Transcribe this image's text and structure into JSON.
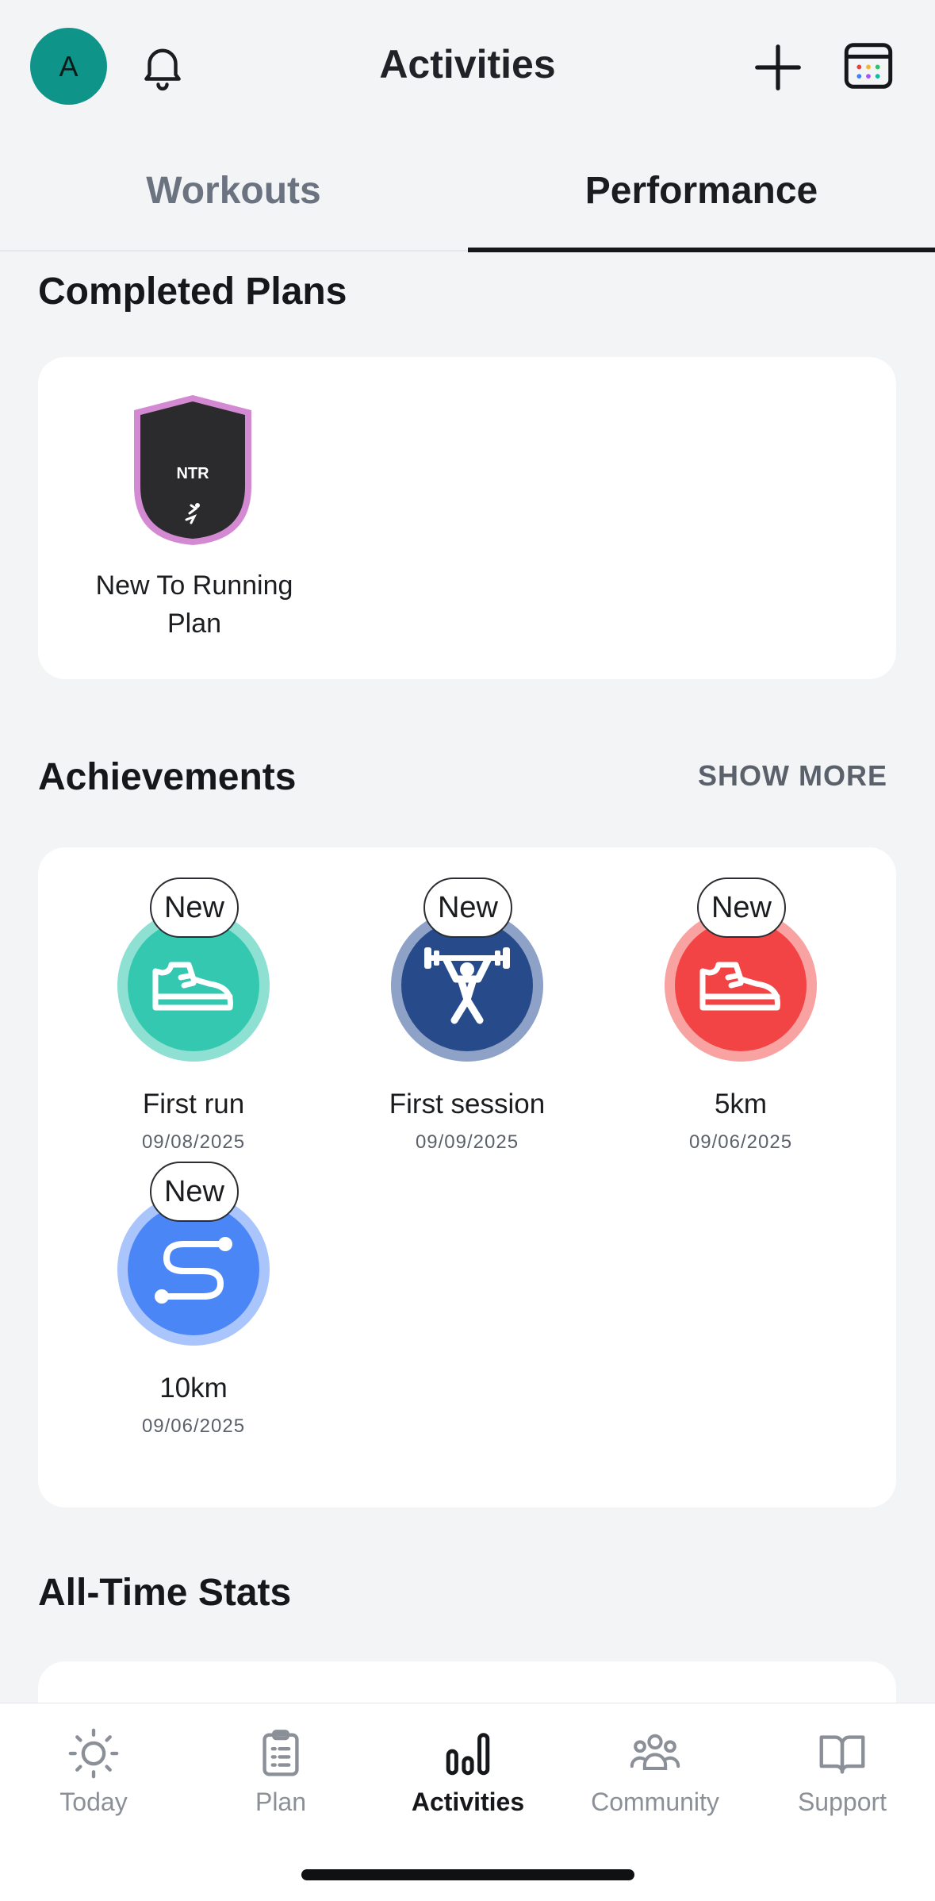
{
  "header": {
    "avatar_initial": "A",
    "title": "Activities"
  },
  "tabs": [
    {
      "label": "Workouts",
      "active": false
    },
    {
      "label": "Performance",
      "active": true
    }
  ],
  "completed_plans": {
    "title": "Completed Plans",
    "plans": [
      {
        "badge_text": "NTR",
        "label": "New To Running Plan",
        "label_line1": "New To Running",
        "label_line2": "Plan",
        "border_color": "#d38ad2"
      }
    ]
  },
  "achievements": {
    "title": "Achievements",
    "show_more": "SHOW MORE",
    "items": [
      {
        "badge": "New",
        "name": "First run",
        "date": "09/08/2025",
        "icon": "shoe-icon",
        "color": "#34c8b1",
        "ring": "#8de0d2"
      },
      {
        "badge": "New",
        "name": "First session",
        "date": "09/09/2025",
        "icon": "weightlifter-icon",
        "color": "#264a8a",
        "ring": "#8ea1c6"
      },
      {
        "badge": "New",
        "name": "5km",
        "date": "09/06/2025",
        "icon": "shoe-icon",
        "color": "#f24444",
        "ring": "#f8a2a2"
      },
      {
        "badge": "New",
        "name": "10km",
        "date": "09/06/2025",
        "icon": "route-icon",
        "color": "#4b86f7",
        "ring": "#a9c5fb"
      }
    ]
  },
  "stats": {
    "title": "All-Time Stats"
  },
  "bottom_nav": [
    {
      "label": "Today",
      "icon": "sun-icon",
      "active": false
    },
    {
      "label": "Plan",
      "icon": "clipboard-icon",
      "active": false
    },
    {
      "label": "Activities",
      "icon": "bar-chart-icon",
      "active": true
    },
    {
      "label": "Community",
      "icon": "people-icon",
      "active": false
    },
    {
      "label": "Support",
      "icon": "book-icon",
      "active": false
    }
  ]
}
